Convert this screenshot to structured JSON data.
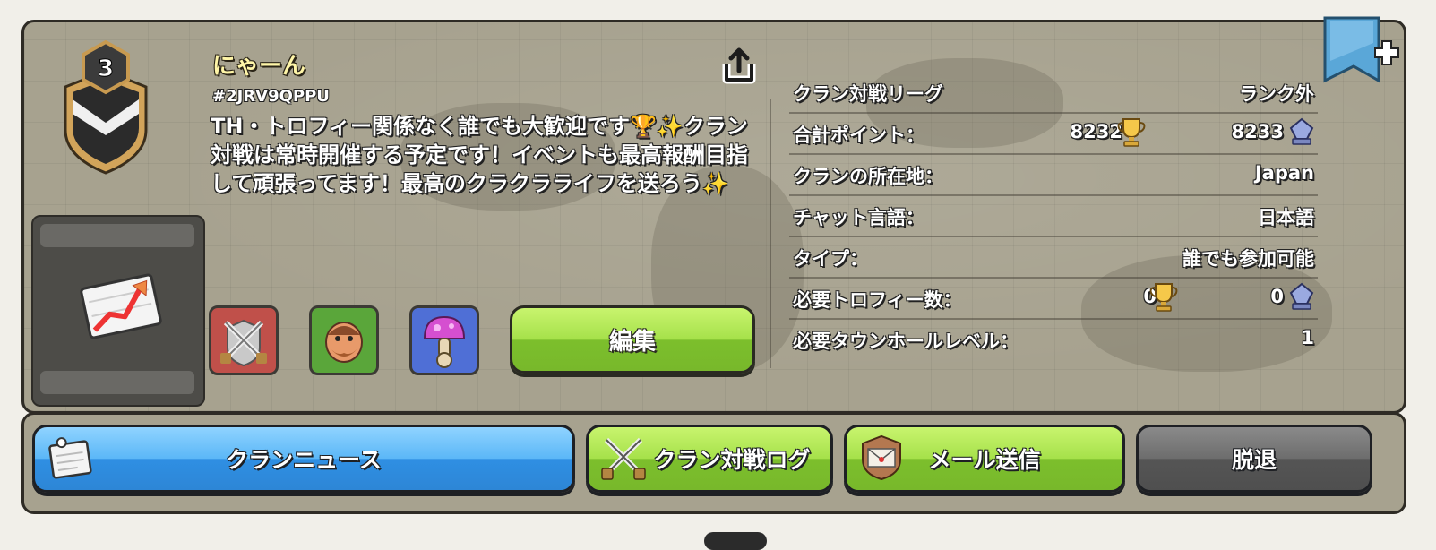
{
  "clan": {
    "level": "3",
    "name": "にゃーん",
    "tag": "#2JRV9QPPU",
    "description": "TH・トロフィー関係なく誰でも大歓迎です🏆✨クラン対戦は常時開催する予定です！イベントも最高報酬目指して頑張ってます！最高のクラクラライフを送ろう✨"
  },
  "actions": {
    "edit_label": "編集"
  },
  "labels": [
    {
      "icon": "crossed-swords-icon",
      "color": "#c0504a"
    },
    {
      "icon": "builder-face-icon",
      "color": "#5aa63a"
    },
    {
      "icon": "pink-mushroom-icon",
      "color": "#4f6fd6"
    }
  ],
  "info": {
    "war_league": {
      "label": "クラン対戦リーグ",
      "value": "ランク外"
    },
    "total_points": {
      "label": "合計ポイント：",
      "trophies": "8232",
      "builder": "8233"
    },
    "location": {
      "label": "クランの所在地：",
      "value": "Japan"
    },
    "chat_language": {
      "label": "チャット言語：",
      "value": "日本語"
    },
    "type": {
      "label": "タイプ：",
      "value": "誰でも参加可能"
    },
    "required_trophies": {
      "label": "必要トロフィー数：",
      "trophies": "0",
      "builder": "0"
    },
    "required_th": {
      "label": "必要タウンホールレベル：",
      "value": "1"
    }
  },
  "bottom_buttons": {
    "news": "クランニュース",
    "war_log": "クラン対戦ログ",
    "mail": "メール送信",
    "leave": "脱退"
  },
  "colors": {
    "green_button": "#a6e14a",
    "blue_button": "#5bb7f7",
    "gray_button": "#6d6d6d",
    "name_yellow": "#fff6a8"
  }
}
